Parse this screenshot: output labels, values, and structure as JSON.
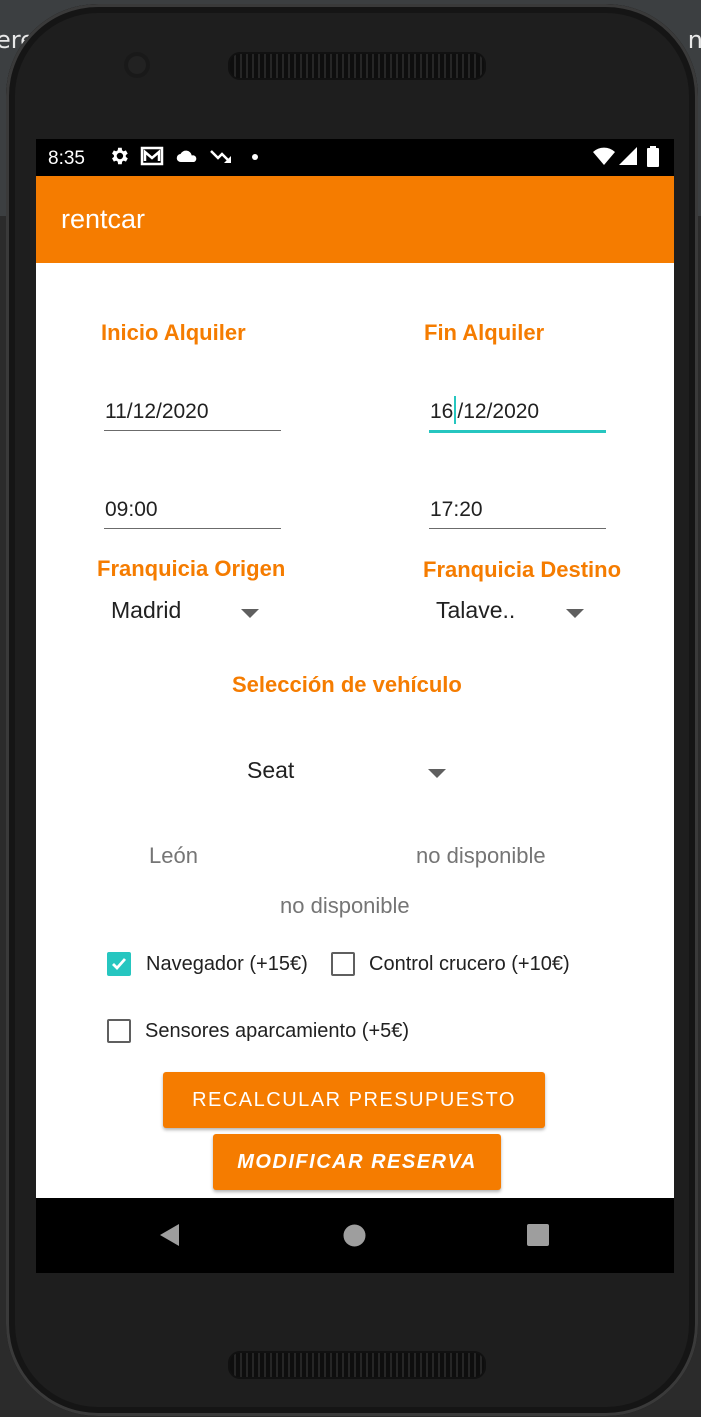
{
  "background": {
    "left_fragment": "ere",
    "right_fragment": "n"
  },
  "status_bar": {
    "time": "8:35",
    "icons_left": [
      "gear-icon",
      "gmail-icon",
      "cloud-icon",
      "trending-down-icon",
      "dot-icon"
    ],
    "icons_right": [
      "wifi-icon",
      "signal-icon",
      "battery-icon"
    ]
  },
  "app_bar": {
    "title": "rentcar",
    "color": "#f57c00"
  },
  "rental": {
    "start": {
      "label": "Inicio Alquiler",
      "date": "11/12/2020",
      "time": "09:00"
    },
    "end": {
      "label": "Fin Alquiler",
      "date_before_cursor": "16",
      "date_after_cursor": "/12/2020",
      "time": "17:20"
    }
  },
  "franchise": {
    "origin": {
      "label": "Franquicia Origen",
      "value": "Madrid"
    },
    "destination": {
      "label": "Franquicia Destino",
      "value": "Talave.."
    }
  },
  "vehicle": {
    "label": "Selección de vehículo",
    "brand": "Seat",
    "model": "León",
    "status_1": "no disponible",
    "status_2": "no disponible"
  },
  "extras": [
    {
      "label": "Navegador (+15€)",
      "checked": true
    },
    {
      "label": "Control crucero (+10€)",
      "checked": false
    },
    {
      "label": "Sensores aparcamiento (+5€)",
      "checked": false
    }
  ],
  "buttons": {
    "recalculate": "RECALCULAR PRESUPUESTO",
    "modify": "MODIFICAR RESERVA"
  },
  "nav_bar": {
    "icons": [
      "back-icon",
      "home-icon",
      "recents-icon"
    ]
  },
  "colors": {
    "accent": "#f57c00",
    "focus": "#26c6c0"
  }
}
